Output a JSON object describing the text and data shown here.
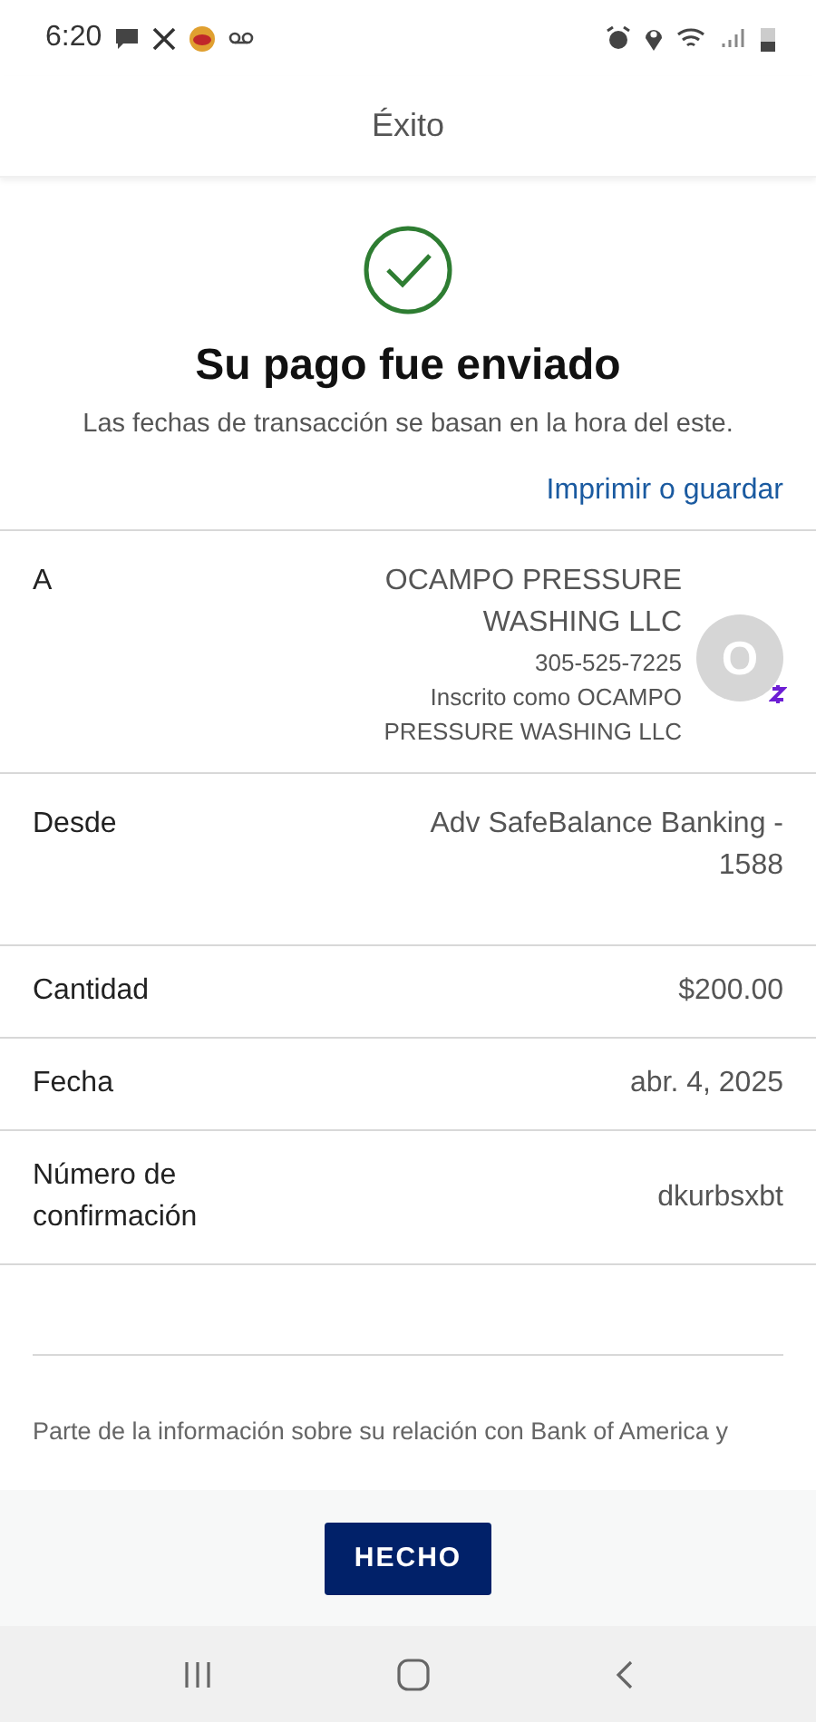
{
  "status_bar": {
    "time": "6:20"
  },
  "header": {
    "title": "Éxito"
  },
  "confirmation": {
    "title": "Su pago fue enviado",
    "subtitle": "Las fechas de transacción se basan en la hora del este.",
    "print_link": "Imprimir o guardar"
  },
  "recipient": {
    "label": "A",
    "name": "OCAMPO PRESSURE WASHING LLC",
    "phone": "305-525-7225",
    "enrolled": "Inscrito como OCAMPO PRESSURE WASHING LLC",
    "avatar_letter": "O"
  },
  "details": [
    {
      "label": "Desde",
      "value": "Adv SafeBalance Banking - 1588"
    },
    {
      "label": "Cantidad",
      "value": "$200.00"
    },
    {
      "label": "Fecha",
      "value": "abr. 4, 2025"
    },
    {
      "label": "Número de confirmación",
      "value": "dkurbsxbt"
    }
  ],
  "disclaimer": "Parte de la información sobre su relación con Bank of America y",
  "done_button": "HECHO"
}
